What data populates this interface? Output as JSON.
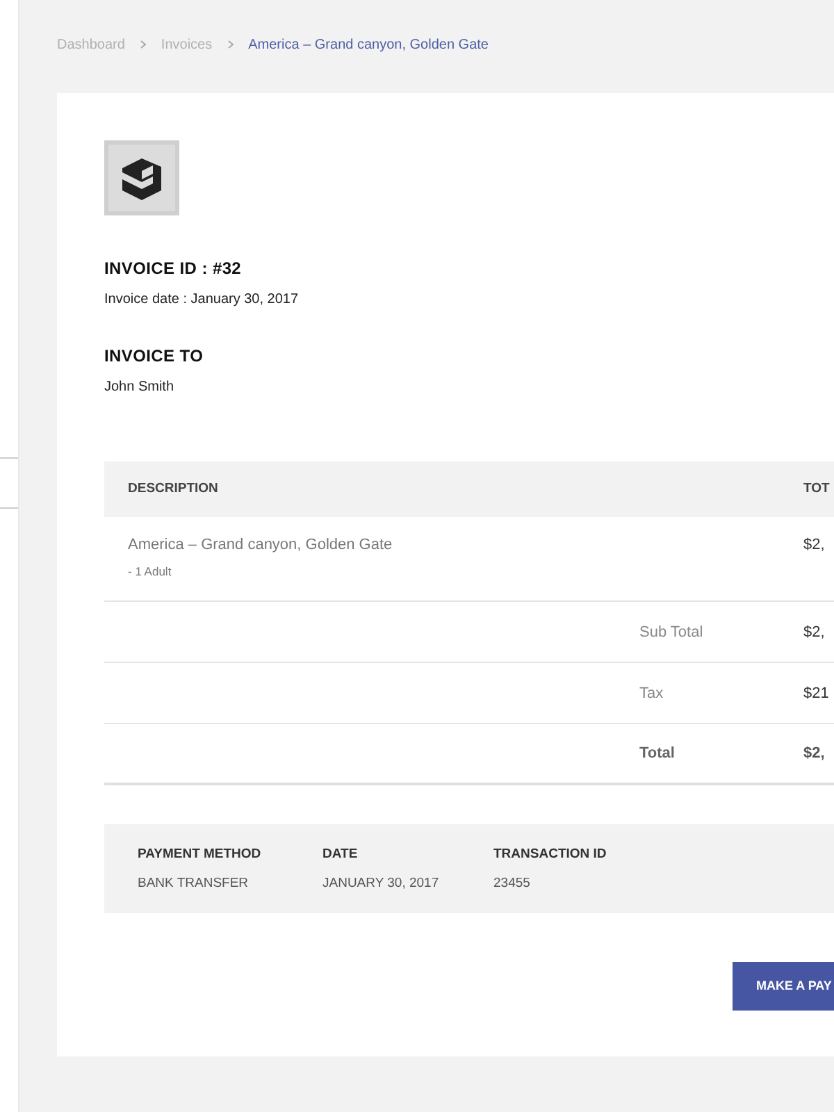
{
  "breadcrumb": [
    {
      "label": "Dashboard",
      "selected": false
    },
    {
      "label": "Invoices",
      "selected": false
    },
    {
      "label": "America – Grand canyon, Golden Gate",
      "selected": true
    }
  ],
  "invoice": {
    "id": "INVOICE ID : #32",
    "date": "Invoice date : January 30, 2017",
    "to_heading": "INVOICE TO",
    "to_name": "John Smith"
  },
  "table": {
    "columns": [
      "DESCRIPTION",
      "TOT"
    ],
    "items": [
      {
        "name": "America – Grand canyon, Golden Gate",
        "detail": "- 1 Adult",
        "total": "$2,"
      }
    ],
    "summary": [
      {
        "label": "Sub Total",
        "value": "$2,",
        "kind": "plain"
      },
      {
        "label": "Tax",
        "value": "$21",
        "kind": "plain"
      },
      {
        "label": "Total",
        "value": "$2,",
        "kind": "grand"
      }
    ]
  },
  "payment": [
    {
      "heading": "PAYMENT METHOD",
      "value": "BANK TRANSFER"
    },
    {
      "heading": "DATE",
      "value": "JANUARY 30, 2017"
    },
    {
      "heading": "TRANSACTION ID",
      "value": "23455"
    }
  ],
  "action_button": "MAKE A PAY"
}
